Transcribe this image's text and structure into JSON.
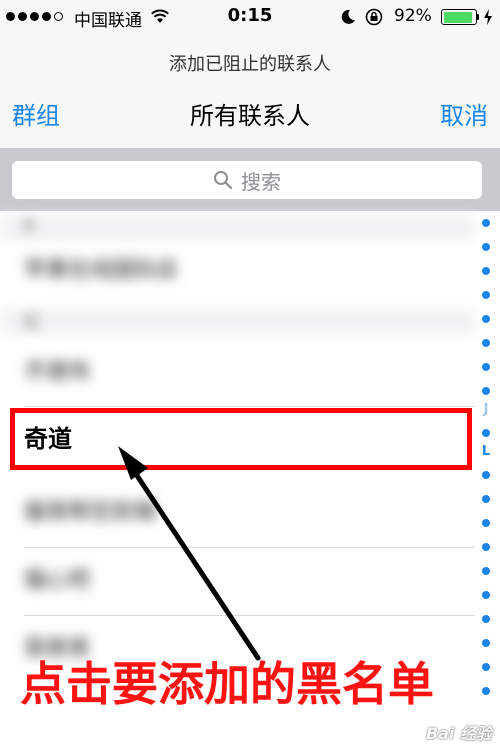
{
  "status_bar": {
    "carrier": "中国联通",
    "time": "0:15",
    "battery_percent": "92%",
    "battery_level": 0.92,
    "signal_bars_filled": 4,
    "signal_bars_total": 5,
    "battery_color": "#4cd964"
  },
  "nav": {
    "prompt": "添加已阻止的联系人",
    "title": "所有联系人",
    "left_button": "群组",
    "right_button": "取消",
    "accent_color": "#1a86e8"
  },
  "search": {
    "placeholder": "搜索",
    "icon": "search-icon"
  },
  "contacts": {
    "sections": [
      {
        "header": "P",
        "items": [
          "苹果在线国际店"
        ]
      },
      {
        "header": "Q",
        "items": [
          "齐德伟",
          "奇道",
          "猫哥帮您剪辑",
          "猫心吧",
          "我爸爸"
        ]
      }
    ],
    "highlighted_contact": "奇道"
  },
  "index_bar": {
    "letters": [
      "J",
      "L"
    ]
  },
  "annotation": {
    "text": "点击要添加的黑名单",
    "color": "#ff1212"
  },
  "watermark": {
    "text": "Bai 经验"
  }
}
